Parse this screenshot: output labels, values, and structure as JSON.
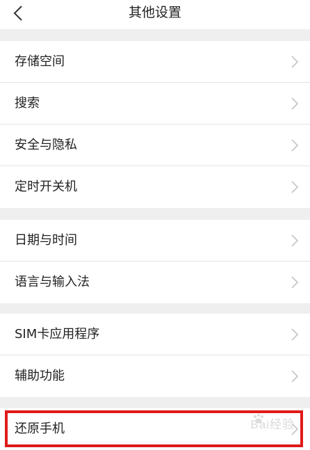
{
  "header": {
    "title": "其他设置",
    "back_icon": "chevron-left-icon"
  },
  "groups": [
    {
      "items": [
        {
          "label": "存储空间"
        },
        {
          "label": "搜索"
        },
        {
          "label": "安全与隐私"
        },
        {
          "label": "定时开关机"
        }
      ]
    },
    {
      "items": [
        {
          "label": "日期与时间"
        },
        {
          "label": "语言与输入法"
        }
      ]
    },
    {
      "items": [
        {
          "label": "SIM卡应用程序"
        },
        {
          "label": "辅助功能"
        }
      ]
    },
    {
      "items": [
        {
          "label": "还原手机"
        }
      ]
    }
  ],
  "item_icon": "chevron-right-icon",
  "highlight_color": "#e01a1a",
  "section_gap_color": "#efefef",
  "watermark": "Bai经验"
}
